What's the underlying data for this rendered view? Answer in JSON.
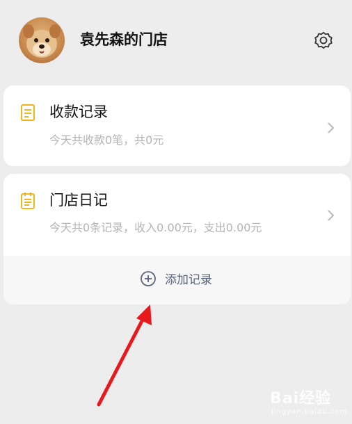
{
  "header": {
    "shop_name": "袁先森的门店"
  },
  "cards": {
    "receipts": {
      "title": "收款记录",
      "subtitle": "今天共收款0笔，共0元"
    },
    "diary": {
      "title": "门店日记",
      "subtitle": "今天共0条记录，收入0.00元，支出0.00元",
      "add_label": "添加记录"
    }
  },
  "icons": {
    "settings": "gear-icon",
    "receipts": "document-icon",
    "diary": "notepad-icon",
    "chevron": "chevron-right-icon",
    "add": "plus-circle-icon"
  },
  "colors": {
    "accent_icon": "#f2b418",
    "annotation_arrow": "#e8191c",
    "add_label": "#5a6478"
  },
  "watermark": {
    "text": "Bai经验",
    "sub": "jingyan.baidu.com"
  }
}
